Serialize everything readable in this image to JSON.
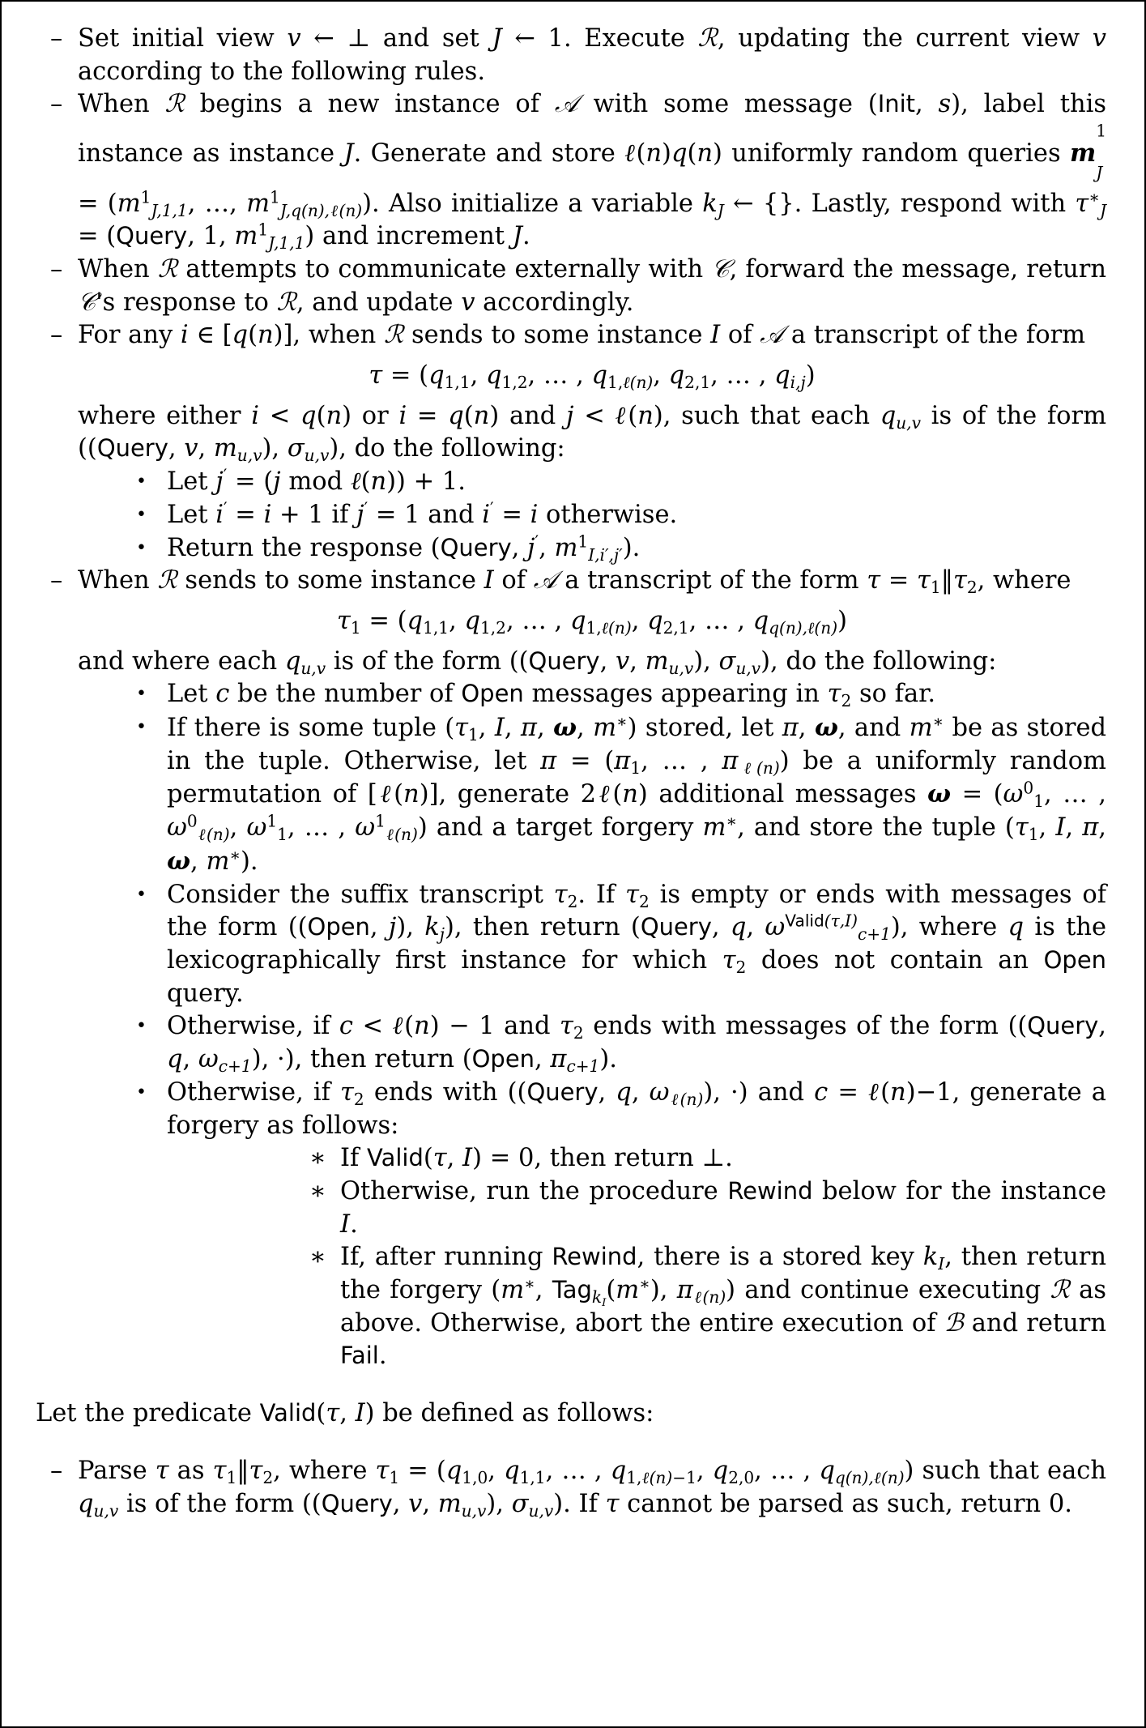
{
  "document": {
    "type": "cryptographic-proof-page",
    "page_bg": "#ffffff",
    "text_color": "#000000",
    "border_color": "#000000"
  },
  "markers": {
    "dash": "–",
    "bullet": "•",
    "star": "∗"
  },
  "items": {
    "i1": {
      "text_parts": [
        "Set initial view ",
        "v",
        " ← ⊥ and set ",
        "J",
        " ← 1. Execute ",
        "R",
        ", updating the current view ",
        "v",
        " according to the following rules."
      ]
    },
    "i2": {
      "line1a": "When ",
      "sym_R": "ℛ",
      "line1b": " begins a new instance of ",
      "sym_A": "𝒜",
      "line1c": " with some message (",
      "kw_init": "Init",
      "line1d": ", ",
      "sym_s": "s",
      "line1e": "), label this instance as instance ",
      "sym_J": "J",
      "line1f": ". Generate and store ",
      "ell_n": "ℓ(n)",
      "q_n": "q(n)",
      "line1g": " uniformly random queries ",
      "line2a": ". Also initialize a variable ",
      "sym_kJ": "k",
      "line2b": " ← {}. Lastly, respond with ",
      "kw_query": "Query",
      "line2c": " and increment ",
      "line2d": "."
    },
    "i3": {
      "text": "When ℛ attempts to communicate externally with 𝒞, forward the message, return 𝒞's response to ℛ, and update v accordingly."
    },
    "i4": {
      "intro": "For any i ∈ [q(n)], when ℛ sends to some instance I of 𝒜 a transcript of the form",
      "after": "where either i < q(n) or i = q(n) and j < ℓ(n), such that each q_{u,v} is of the form ((Query, v, m_{u,v}), σ_{u,v}), do the following:"
    },
    "i5": {
      "intro": "When ℛ sends to some instance I of 𝒜 a transcript of the form τ = τ1||τ2, where",
      "after": "and where each q_{u,v} is of the form ((Query, v, m_{u,v}), σ_{u,v}), do the following:"
    },
    "b1": {
      "text": "Let j′ = (j mod ℓ(n)) + 1."
    },
    "b2": {
      "text": "Let i′ = i + 1 if j′ = 1 and i′ = i otherwise."
    },
    "b3": {
      "text": "Return the response (Query, j′, m^1_{I,i′,j′})."
    },
    "c1": {
      "text": "Let c be the number of Open messages appearing in τ2 so far."
    },
    "c2": {
      "text": "If there is some tuple (τ1, I, π, ω, m*) stored, let π, ω, and m* be as stored in the tuple. Otherwise, let π = (π1, ..., π_{ℓ(n)}) be a uniformly random permutation of [ℓ(n)], generate 2ℓ(n) additional messages ω = (ω^0_1, ..., ω^0_{ℓ(n)}, ω^1_1, ..., ω^1_{ℓ(n)}) and a target forgery m*, and store the tuple (τ1, I, π, ω, m*)."
    },
    "c3": {
      "text": "Consider the suffix transcript τ2. If τ2 is empty or ends with messages of the form ((Open, j), k_j), then return (Query, q, ω^{Valid(τ,I)}_{c+1}), where q is the lexicographically first instance for which τ2 does not contain an Open query."
    },
    "c4": {
      "text": "Otherwise, if c < ℓ(n) − 1 and τ2 ends with messages of the form ((Query, q, ω_{c+1}), ·), then return (Open, π_{c+1})."
    },
    "c5": {
      "text": "Otherwise, if τ2 ends with ((Query, q, ω_{ℓ(n)}), ·) and c = ℓ(n)−1, generate a forgery as follows:"
    },
    "s1": {
      "text": "If Valid(τ, I) = 0, then return ⊥."
    },
    "s2": {
      "text": "Otherwise, run the procedure Rewind below for the instance I."
    },
    "s3": {
      "text": "If, after running Rewind, there is a stored key k_I, then return the forgery (m*, Tag_{k_I}(m*), π_{ℓ(n)}) and continue executing ℛ as above. Otherwise, abort the entire execution of ℬ and return Fail."
    },
    "valid_intro": {
      "text": "Let the predicate Valid(τ, I) be defined as follows:"
    },
    "v1": {
      "text": "Parse τ as τ1||τ2, where τ1 = (q_{1,0}, q_{1,1}, ..., q_{1,ℓ(n)−1}, q_{2,0}, ..., q_{q(n),ℓ(n)}) such that each q_{u,v} is of the form ((Query, v, m_{u,v}), σ_{u,v}). If τ cannot be parsed as such, return 0."
    }
  },
  "equations": {
    "eq_tau": "τ = (q_{1,1}, q_{1,2}, …, q_{1,ℓ(n)}, q_{2,1}, …, q_{i,j})",
    "eq_tau1": "τ1 = (q_{1,1}, q_{1,2}, …, q_{1,ℓ(n)}, q_{2,1}, …, q_{q(n),ℓ(n)})"
  },
  "keywords": {
    "init": "Init",
    "query": "Query",
    "open": "Open",
    "valid": "Valid",
    "rewind": "Rewind",
    "tag": "Tag",
    "fail": "Fail"
  }
}
